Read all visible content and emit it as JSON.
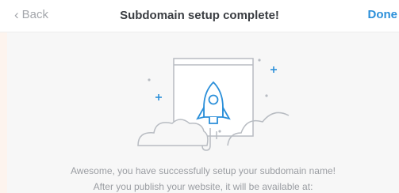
{
  "header": {
    "back_label": "Back",
    "back_icon": "chevron-left-icon",
    "title": "Subdomain setup complete!",
    "done_label": "Done"
  },
  "illustration": {
    "name": "rocket-launch-illustration",
    "colors": {
      "line": "#b8bcc2",
      "accent": "#2b8fd9"
    }
  },
  "message": {
    "line1": "Awesome, you have successfully setup your subdomain name!",
    "line2": "After you publish your website, it will be available at:"
  },
  "colors": {
    "brand": "#2b8fd9",
    "muted_text": "#9a9da2",
    "title_text": "#3a3d42"
  }
}
